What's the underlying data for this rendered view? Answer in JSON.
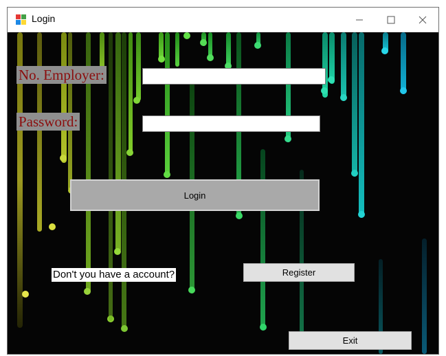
{
  "window": {
    "title": "Login",
    "minimize_symbol": "—",
    "maximize_symbol": "☐",
    "close_symbol": "✕"
  },
  "form": {
    "employer_label": "No. Employer:",
    "employer_value": "",
    "password_label": "Password:",
    "password_value": "",
    "login_button": "Login",
    "question_text": "Don't you have a account?",
    "register_button": "Register",
    "exit_button": "Exit"
  },
  "colors": {
    "label_text": "#8b0d0d",
    "label_background": "#8f8f8f",
    "login_button_bg": "#a9a9a9",
    "button_bg": "#e1e1e1"
  },
  "icons": {
    "app": "winforms-app-icon",
    "minimize": "minimize-icon",
    "maximize": "maximize-icon",
    "close": "close-icon"
  }
}
